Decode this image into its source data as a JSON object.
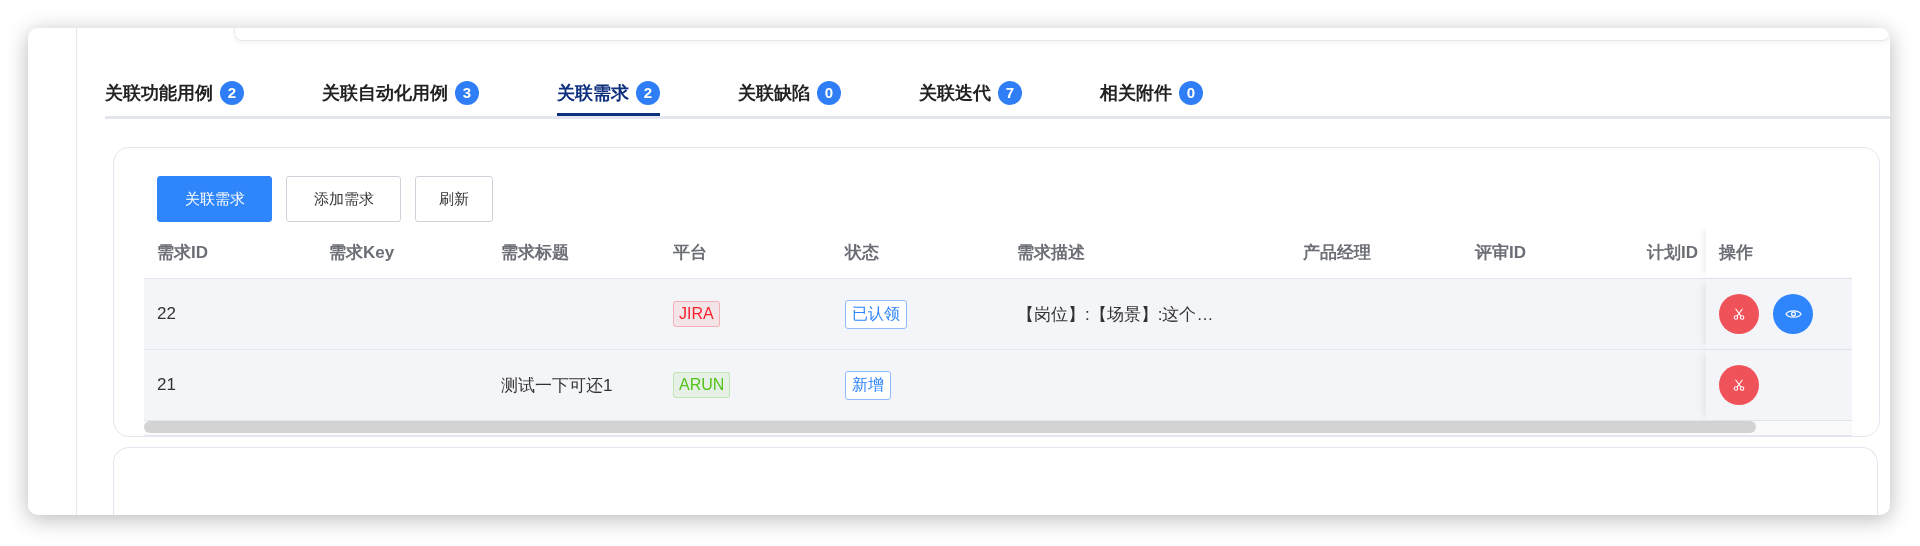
{
  "tabs": [
    {
      "label": "关联功能用例",
      "count": "2",
      "selected": false
    },
    {
      "label": "关联自动化用例",
      "count": "3",
      "selected": false
    },
    {
      "label": "关联需求",
      "count": "2",
      "selected": true
    },
    {
      "label": "关联缺陷",
      "count": "0",
      "selected": false
    },
    {
      "label": "关联迭代",
      "count": "7",
      "selected": false
    },
    {
      "label": "相关附件",
      "count": "0",
      "selected": false
    }
  ],
  "toolbar": [
    {
      "label": "关联需求",
      "kind": "primary"
    },
    {
      "label": "添加需求",
      "kind": "default"
    },
    {
      "label": "刷新",
      "kind": "default"
    }
  ],
  "table": {
    "columns": [
      "需求ID",
      "需求Key",
      "需求标题",
      "平台",
      "状态",
      "需求描述",
      "产品经理",
      "评审ID",
      "计划ID",
      "操作"
    ],
    "rows": [
      {
        "id": "22",
        "platform": {
          "text": "JIRA",
          "color": "#f5222d"
        },
        "status": "已认领",
        "description": "【岗位】:【场景】:这个…",
        "actions": [
          {
            "kind": "cut"
          },
          {
            "kind": "view"
          }
        ]
      },
      {
        "id": "21",
        "title": "测试一下可还1",
        "platform": {
          "text": "ARUN",
          "color": "#52c41a"
        },
        "status": "新增",
        "actions": [
          {
            "kind": "cut"
          }
        ]
      }
    ]
  }
}
